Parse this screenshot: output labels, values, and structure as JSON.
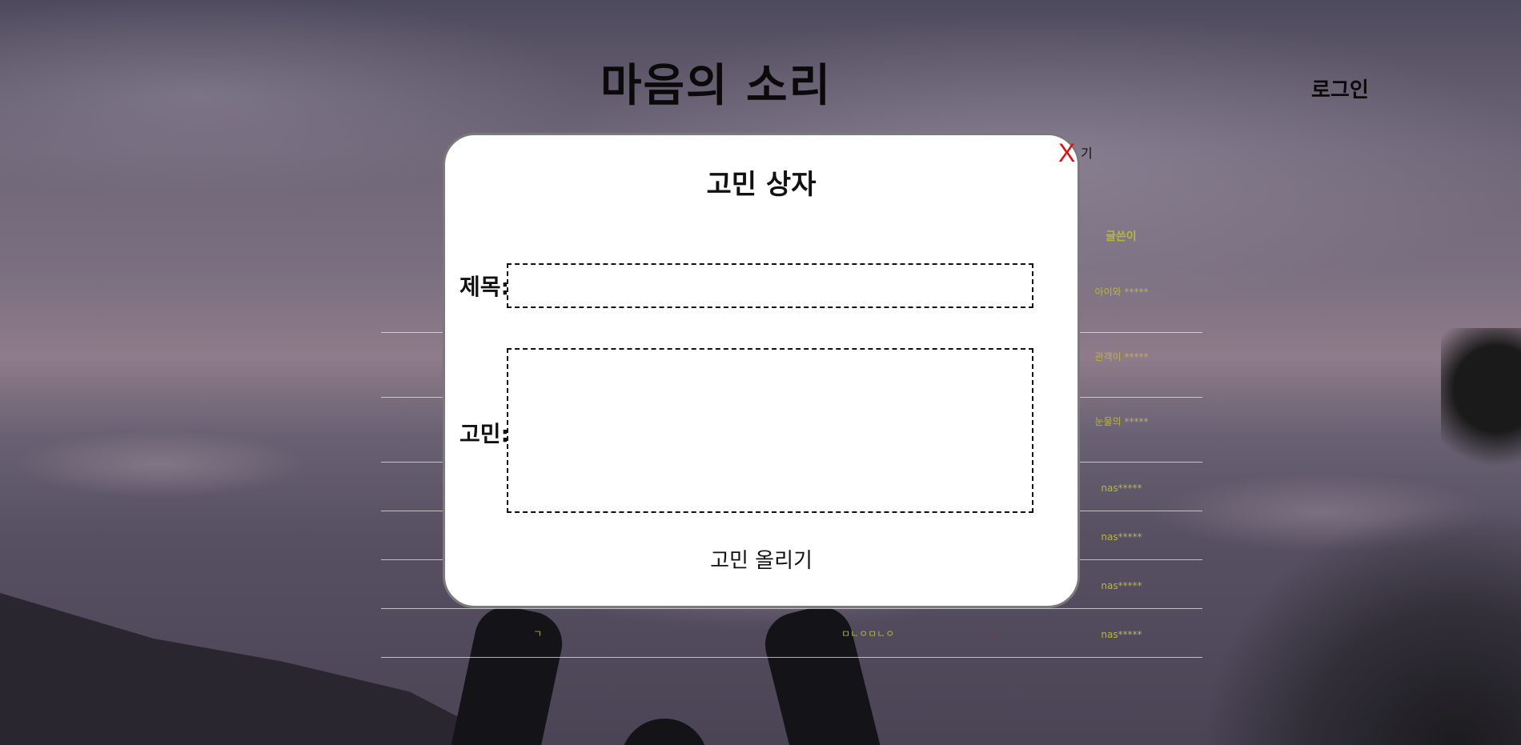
{
  "header": {
    "site_title": "마음의 소리",
    "login_label": "로그인"
  },
  "board": {
    "author_header": "글쓴이",
    "partial_header_text": "기",
    "rows": [
      {
        "num": "",
        "title": "",
        "heart": "",
        "author": "아이와 *****"
      },
      {
        "num": "",
        "title": "",
        "heart": "",
        "author": "관객이 *****"
      },
      {
        "num": "",
        "title": "",
        "heart": "",
        "author": "눈물의 *****"
      },
      {
        "num": "",
        "title": "",
        "heart": "",
        "author": "nas*****"
      },
      {
        "num": "",
        "title": "",
        "heart": "",
        "author": "nas*****"
      },
      {
        "num": "",
        "title": "",
        "heart": "",
        "author": "nas*****"
      },
      {
        "num": "ㄱ",
        "title": "ㅁㄴㅇㅁㄴㅇ",
        "heart": "♡",
        "author": "nas*****"
      }
    ]
  },
  "modal": {
    "close_label": "X",
    "title": "고민 상자",
    "title_field_label": "제목:",
    "concern_field_label": "고민:",
    "title_value": "",
    "concern_value": "",
    "submit_label": "고민 올리기"
  },
  "colors": {
    "modal_border": "#7a7a7a",
    "close": "#e01010",
    "board_text": "#b9b834"
  }
}
